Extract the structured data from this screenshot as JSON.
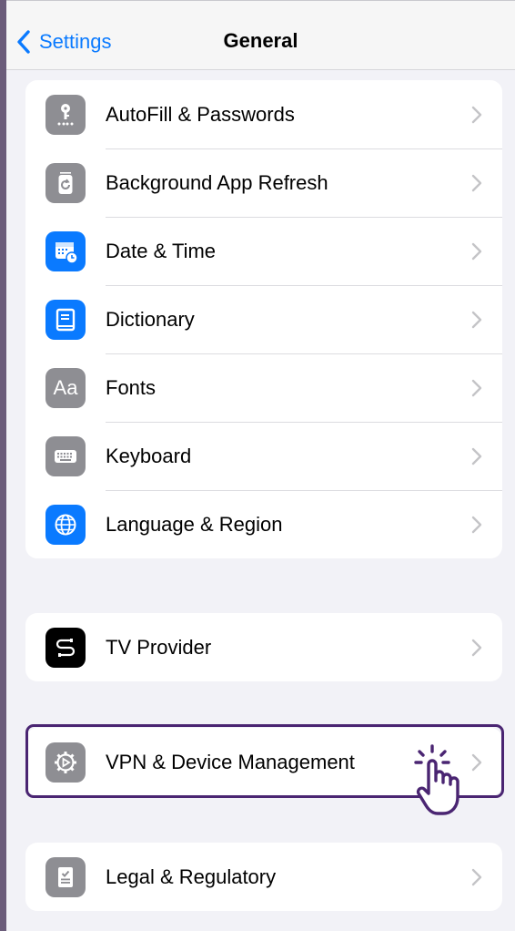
{
  "navbar": {
    "back_label": "Settings",
    "title": "General",
    "back_icon": "chevron-left-icon"
  },
  "groups": [
    {
      "items": [
        {
          "label": "AutoFill & Passwords",
          "icon": "key-icon",
          "color": "#8e8e93"
        },
        {
          "label": "Background App Refresh",
          "icon": "refresh-icon",
          "color": "#8e8e93"
        },
        {
          "label": "Date & Time",
          "icon": "calendar-clock-icon",
          "color": "#0a7aff"
        },
        {
          "label": "Dictionary",
          "icon": "book-icon",
          "color": "#0a7aff"
        },
        {
          "label": "Fonts",
          "icon": "fonts-icon",
          "icon_text": "Aa",
          "color": "#8e8e93"
        },
        {
          "label": "Keyboard",
          "icon": "keyboard-icon",
          "color": "#8e8e93"
        },
        {
          "label": "Language & Region",
          "icon": "globe-icon",
          "color": "#0a7aff"
        }
      ]
    },
    {
      "items": [
        {
          "label": "TV Provider",
          "icon": "tv-provider-icon",
          "color": "#000000"
        }
      ]
    },
    {
      "items": [
        {
          "label": "VPN & Device Management",
          "icon": "gear-icon",
          "color": "#8e8e93",
          "highlighted": true
        }
      ]
    },
    {
      "items": [
        {
          "label": "Legal & Regulatory",
          "icon": "legal-document-icon",
          "color": "#8e8e93"
        }
      ]
    }
  ],
  "annotation": {
    "icon": "tap-hand-icon",
    "highlight_color": "#4a2572"
  }
}
